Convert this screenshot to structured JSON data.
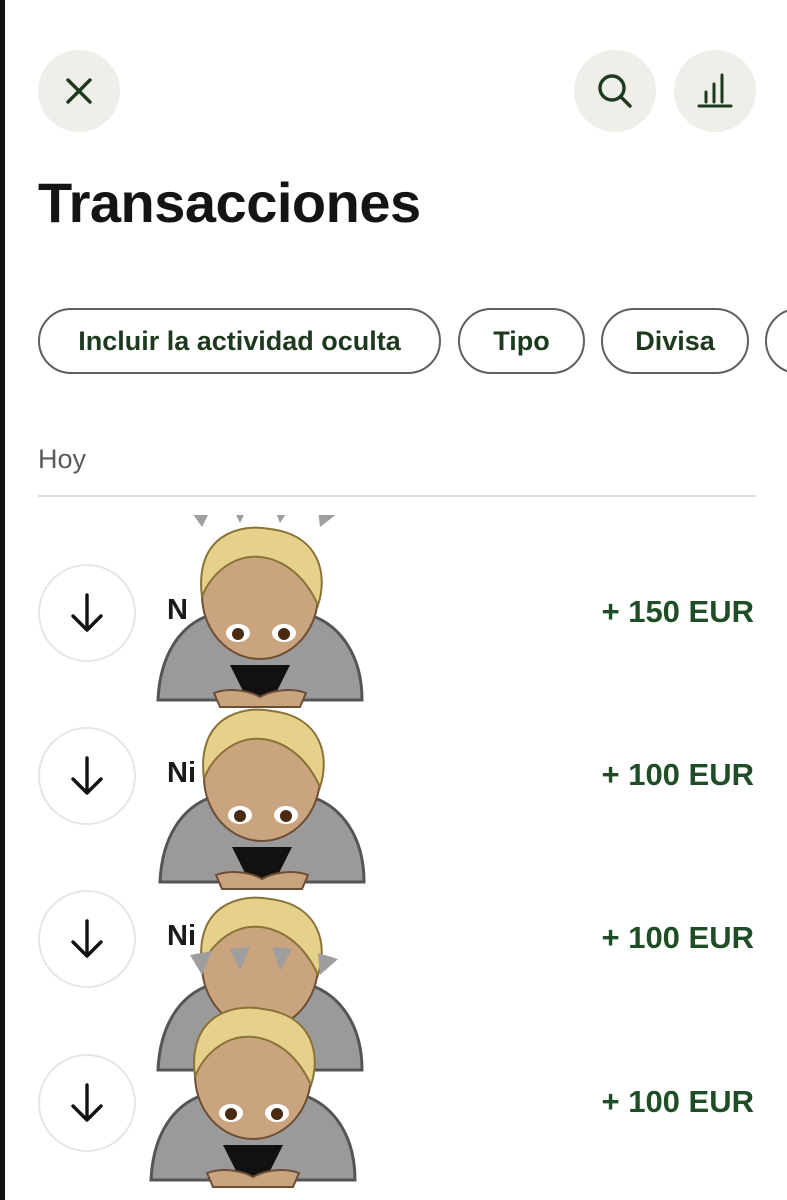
{
  "header": {
    "close_icon": "close-icon",
    "search_icon": "search-icon",
    "stats_icon": "bar-chart-icon"
  },
  "page_title": "Transacciones",
  "filters": [
    {
      "label": "Incluir la actividad oculta"
    },
    {
      "label": "Tipo"
    },
    {
      "label": "Divisa"
    },
    {
      "label": ""
    }
  ],
  "section": {
    "label": "Hoy"
  },
  "transactions": [
    {
      "name": "N",
      "amount": "+ 150 EUR",
      "icon": "arrow-down-icon"
    },
    {
      "name": "Ni",
      "amount": "+ 100 EUR",
      "icon": "arrow-down-icon"
    },
    {
      "name": "Ni",
      "amount": "+ 100 EUR",
      "icon": "arrow-down-icon"
    },
    {
      "name": "",
      "amount": "+ 100 EUR",
      "icon": "arrow-down-icon"
    }
  ],
  "colors": {
    "icon_button_bg": "#efeee9",
    "icon_stroke": "#1d3a1e",
    "amount_green": "#1f4d26",
    "chip_text": "#1d3a1e"
  },
  "overlay": {
    "icon": "bowing-person-emoji"
  }
}
